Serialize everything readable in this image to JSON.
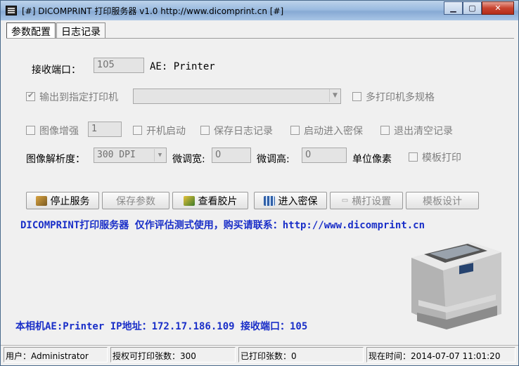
{
  "window": {
    "title": "[#] DICOMPRINT 打印服务器 v1.0   http://www.dicomprint.cn [#]"
  },
  "tabs": [
    {
      "label": "参数配置"
    },
    {
      "label": "日志记录"
    }
  ],
  "config": {
    "port_label": "接收端口：",
    "port_value": "105",
    "ae_label": "AE: Printer",
    "output_printer_label": "输出到指定打印机",
    "output_printer_checked": true,
    "printer_select_value": "",
    "multi_printer_label": "多打印机多规格",
    "image_enhance_label": "图像增强",
    "image_enhance_value": "1",
    "autostart_label": "开机启动",
    "save_log_label": "保存日志记录",
    "secure_start_label": "启动进入密保",
    "clear_on_exit_label": "退出清空记录",
    "resolution_label": "图像解析度：",
    "resolution_value": "300 DPI",
    "fine_width_label": "微调宽:",
    "fine_width_value": "0",
    "fine_height_label": "微调高:",
    "fine_height_value": "0",
    "unit_label": "单位像素",
    "template_print_label": "模板打印"
  },
  "buttons": {
    "stop": "停止服务",
    "save": "保存参数",
    "view": "查看胶片",
    "secure": "进入密保",
    "landscape": "横打设置",
    "template": "模板设计"
  },
  "banner": "DICOMPRINT打印服务器 仅作评估测式使用，购买请联系：http://www.dicomprint.cn",
  "info": "本相机AE:Printer    IP地址：172.17.186.109   接收端口：105",
  "status": {
    "user": "用户：Administrator",
    "quota": "授权可打印张数：300",
    "printed": "已打印张数：0",
    "time": "现在时间：2014-07-07 11:01:20"
  },
  "colors": {
    "accent_text": "#1a2fc8",
    "title_bar": "#9bbbe0",
    "close_button": "#c8432f"
  }
}
